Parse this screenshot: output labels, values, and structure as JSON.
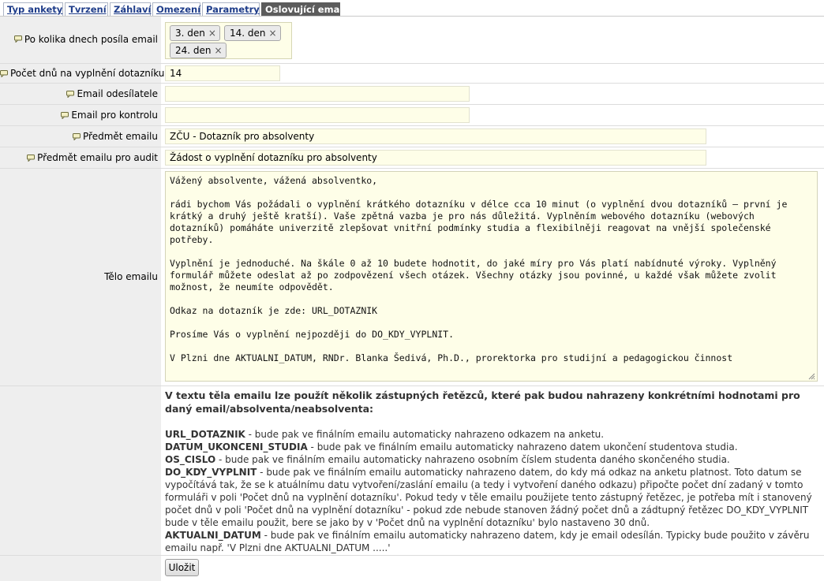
{
  "tabs": [
    {
      "label": "Typ ankety"
    },
    {
      "label": "Tvrzení"
    },
    {
      "label": "Záhlaví"
    },
    {
      "label": "Omezení"
    },
    {
      "label": "Parametry"
    },
    {
      "label": "Oslovující email",
      "active": true
    }
  ],
  "form": {
    "days_label": "Po kolika dnech posíla email",
    "days_chips": [
      "3. den",
      "14. den",
      "24. den"
    ],
    "chip_remove_glyph": "×",
    "fill_days_label": "Počet dnů na vyplnění dotazníku",
    "fill_days_value": "14",
    "sender_label": "Email odesílatele",
    "sender_value": "",
    "control_label": "Email pro kontrolu",
    "control_value": "",
    "subject_label": "Předmět emailu",
    "subject_value": "ZČU - Dotazník pro absolventy",
    "audit_label": "Předmět emailu pro audit",
    "audit_value": "Žádost o vyplnění dotazníku pro absolventy",
    "body_label": "Tělo emailu",
    "body_paragraphs": [
      "Vážený absolvente, vážená absolventko,",
      "rádi bychom Vás požádali o vyplnění krátkého dotazníku v délce cca 10 minut (o vyplnění dvou dotazníků – první je krátký a druhý ještě kratší). Vaše zpětná vazba je pro nás důležitá. Vyplněním webového dotazníku (webových dotazníků) pomáháte univerzitě zlepšovat vnitřní podmínky studia a flexibilněji reagovat na vnější společenské potřeby.",
      "Vyplnění je jednoduché. Na škále 0 až 10 budete hodnotit, do jaké míry pro Vás platí nabídnuté výroky. Vyplněný formulář můžete odeslat až po zodpovězení všech otázek. Všechny otázky jsou povinné, u každé však můžete zvolit možnost, že neumíte odpovědět.",
      "Odkaz na dotazník je zde: URL_DOTAZNIK",
      "Prosíme Vás o vyplnění nejpozději do DO_KDY_VYPLNIT.",
      "V Plzni dne AKTUALNI_DATUM, RNDr. Blanka Šedivá, Ph.D., prorektorka pro studijní a pedagogickou činnost"
    ]
  },
  "info": {
    "heading": "V textu těla emailu lze použít několik zástupných řetězců, které pak budou nahrazeny konkrétními hodnotami pro daný email/absolventa/neabsolventa:",
    "items": [
      {
        "token": "URL_DOTAZNIK",
        "text": " - bude pak ve finálním emailu automaticky nahrazeno odkazem na anketu."
      },
      {
        "token": "DATUM_UKONCENI_STUDIA",
        "text": " - bude pak ve finálním emailu automaticky nahrazeno datem ukončení studentova studia."
      },
      {
        "token": "OS_CISLO",
        "text": " - bude pak ve finálním emailu automaticky nahrazeno osobním číslem studenta daného skončeného studia."
      },
      {
        "token": "DO_KDY_VYPLNIT",
        "text": " - bude pak ve finálním emailu automaticky nahrazeno datem, do kdy má odkaz na anketu platnost. Toto datum se vypočítává tak, že se k atuálnímu datu vytvoření/zaslání emailu (a tedy i vytvoření daného odkazu) připočte počet dní zadaný v tomto formuláři v poli 'Počet dnů na vyplnění dotazníku'. Pokud tedy v těle emailu použijete tento zástupný řetězec, je potřeba mít i stanovený počet dnů v poli 'Počet dnů na vyplnění dotazníku' - pokud zde nebude stanoven žádný počet dnů a zádtupný řetězec DO_KDY_VYPLNIT bude v těle emailu použit, bere se jako by v 'Počet dnů na vyplnění dotazníku' bylo nastaveno 30 dnů."
      },
      {
        "token": "AKTUALNI_DATUM",
        "text": " - bude pak ve finálním emailu automaticky nahrazeno datem, kdy je email odesílán. Typicky bude použito v závěru emailu např. 'V Plzni dne AKTUALNI_DATUM .....'"
      }
    ]
  },
  "actions": {
    "save_label": "Uložit"
  }
}
